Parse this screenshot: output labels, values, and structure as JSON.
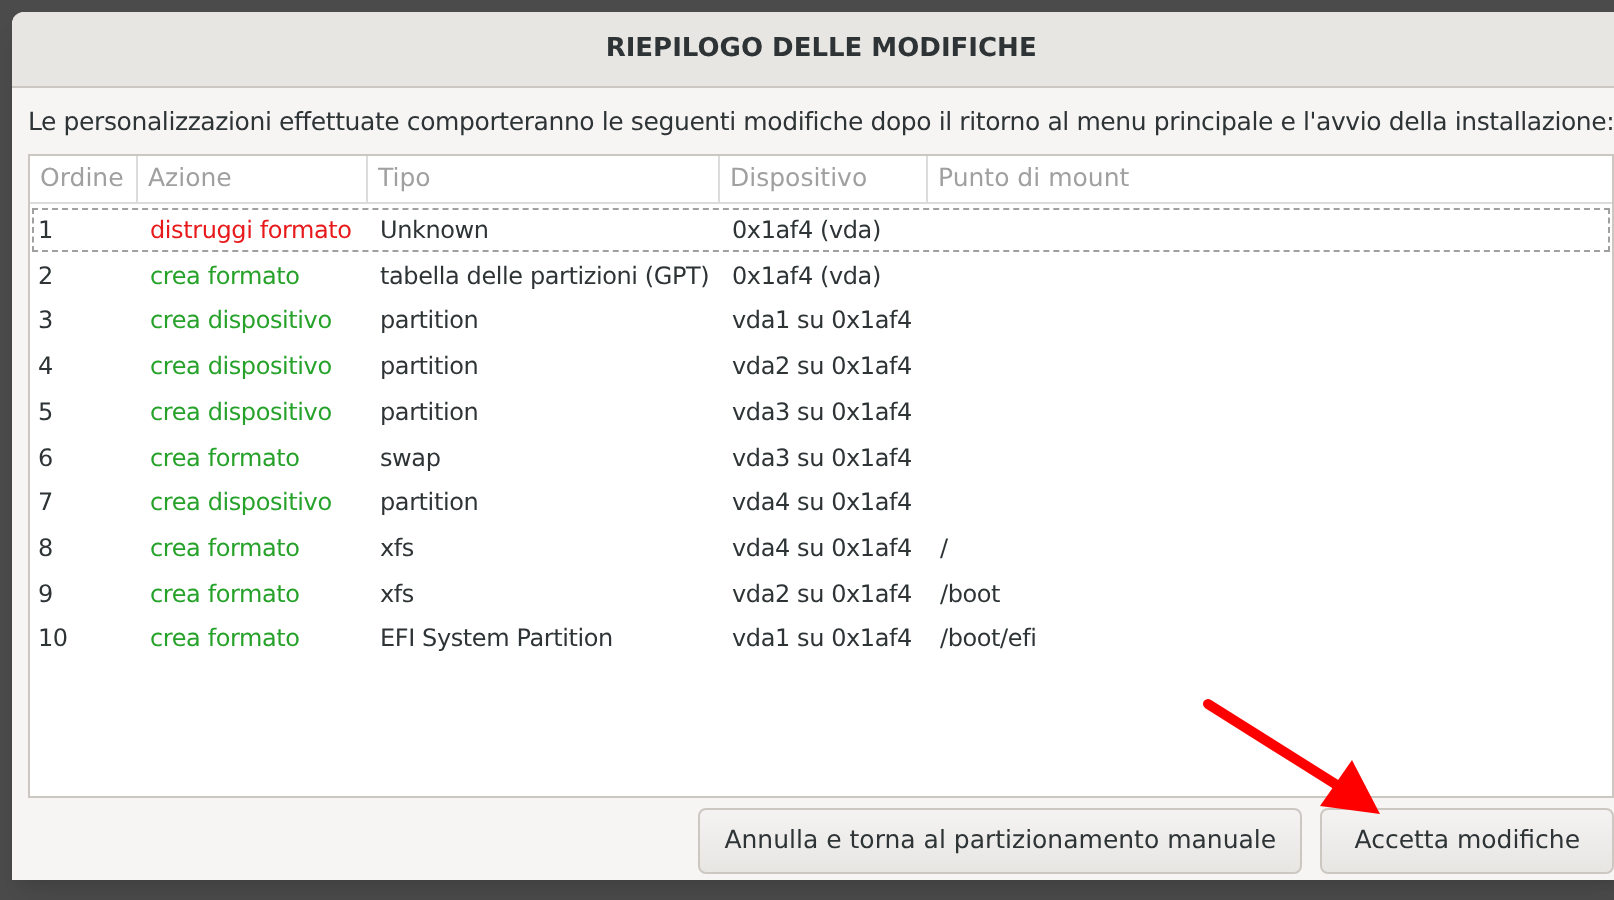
{
  "dialog": {
    "title": "RIEPILOGO DELLE MODIFICHE",
    "description": "Le personalizzazioni effettuate comporteranno le seguenti modifiche dopo il ritorno al menu principale e l'avvio della installazione:"
  },
  "table": {
    "columns": [
      "Ordine",
      "Azione",
      "Tipo",
      "Dispositivo",
      "Punto di mount"
    ],
    "rows": [
      {
        "order": "1",
        "action": "distruggi formato",
        "kind": "destroy",
        "type": "Unknown",
        "device": "0x1af4 (vda)",
        "mount": "",
        "focused": true
      },
      {
        "order": "2",
        "action": "crea formato",
        "kind": "create",
        "type": "tabella delle partizioni (GPT)",
        "device": "0x1af4 (vda)",
        "mount": "",
        "focused": false
      },
      {
        "order": "3",
        "action": "crea dispositivo",
        "kind": "create",
        "type": "partition",
        "device": "vda1 su 0x1af4",
        "mount": "",
        "focused": false
      },
      {
        "order": "4",
        "action": "crea dispositivo",
        "kind": "create",
        "type": "partition",
        "device": "vda2 su 0x1af4",
        "mount": "",
        "focused": false
      },
      {
        "order": "5",
        "action": "crea dispositivo",
        "kind": "create",
        "type": "partition",
        "device": "vda3 su 0x1af4",
        "mount": "",
        "focused": false
      },
      {
        "order": "6",
        "action": "crea formato",
        "kind": "create",
        "type": "swap",
        "device": "vda3 su 0x1af4",
        "mount": "",
        "focused": false
      },
      {
        "order": "7",
        "action": "crea dispositivo",
        "kind": "create",
        "type": "partition",
        "device": "vda4 su 0x1af4",
        "mount": "",
        "focused": false
      },
      {
        "order": "8",
        "action": "crea formato",
        "kind": "create",
        "type": "xfs",
        "device": "vda4 su 0x1af4",
        "mount": "/",
        "focused": false
      },
      {
        "order": "9",
        "action": "crea formato",
        "kind": "create",
        "type": "xfs",
        "device": "vda2 su 0x1af4",
        "mount": "/boot",
        "focused": false
      },
      {
        "order": "10",
        "action": "crea formato",
        "kind": "create",
        "type": "EFI System Partition",
        "device": "vda1 su 0x1af4",
        "mount": "/boot/efi",
        "focused": false
      }
    ]
  },
  "buttons": [
    "Annulla e torna al partizionamento manuale",
    "Accetta modifiche"
  ]
}
